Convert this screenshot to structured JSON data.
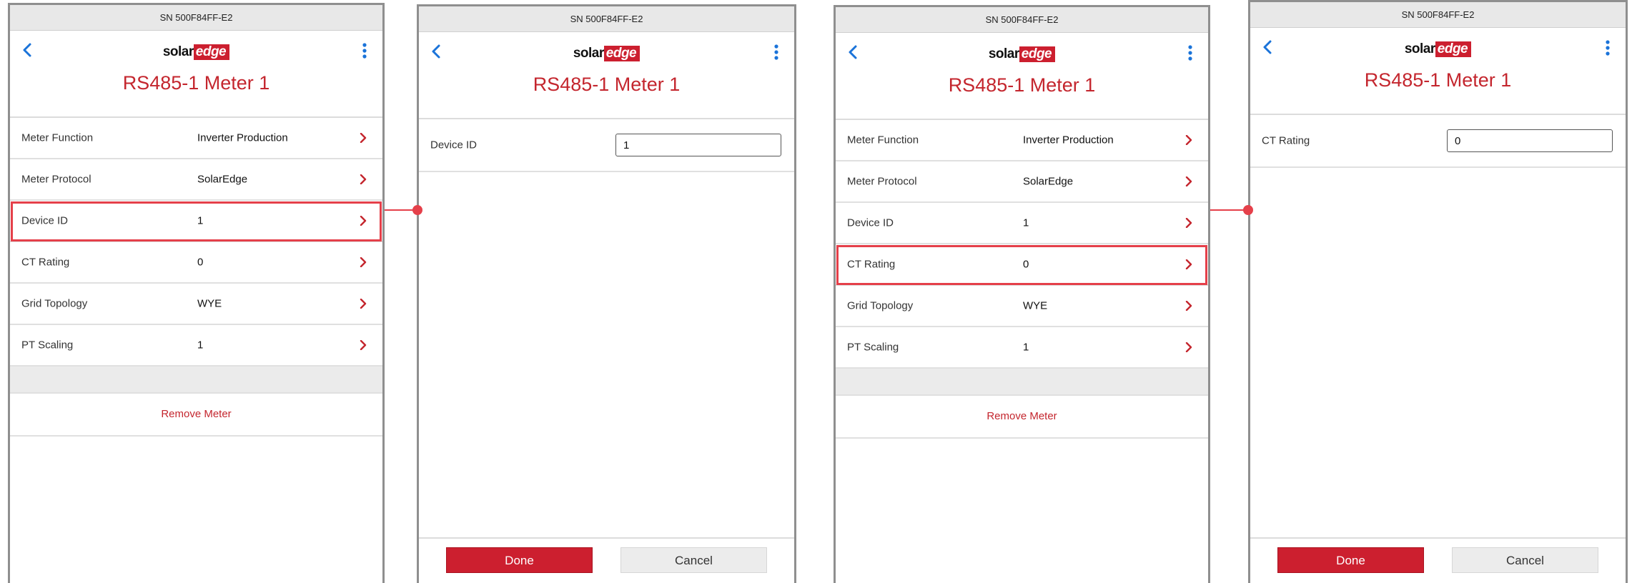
{
  "colors": {
    "brand_red": "#cc1f2f",
    "highlight_red": "#e5404a",
    "title_red": "#c4262e",
    "icon_blue": "#1a73d9"
  },
  "icons": {
    "back": "chevron-left-icon",
    "menu": "kebab-menu-icon",
    "row": "chevron-right-icon"
  },
  "device": {
    "serial": "SN 500F84FF-E2",
    "logo_solar": "solar",
    "logo_edge": "edge",
    "title": "RS485-1 Meter 1"
  },
  "meter_settings": {
    "rows": [
      {
        "label": "Meter Function",
        "value": "Inverter Production"
      },
      {
        "label": "Meter Protocol",
        "value": "SolarEdge"
      },
      {
        "label": "Device ID",
        "value": "1"
      },
      {
        "label": "CT Rating",
        "value": "0"
      },
      {
        "label": "Grid Topology",
        "value": "WYE"
      },
      {
        "label": "PT Scaling",
        "value": "1"
      }
    ],
    "remove_label": "Remove Meter"
  },
  "edit_device_id": {
    "label": "Device ID",
    "value": "1"
  },
  "edit_ct_rating": {
    "label": "CT Rating",
    "value": "0"
  },
  "footer": {
    "done_label": "Done",
    "cancel_label": "Cancel"
  }
}
